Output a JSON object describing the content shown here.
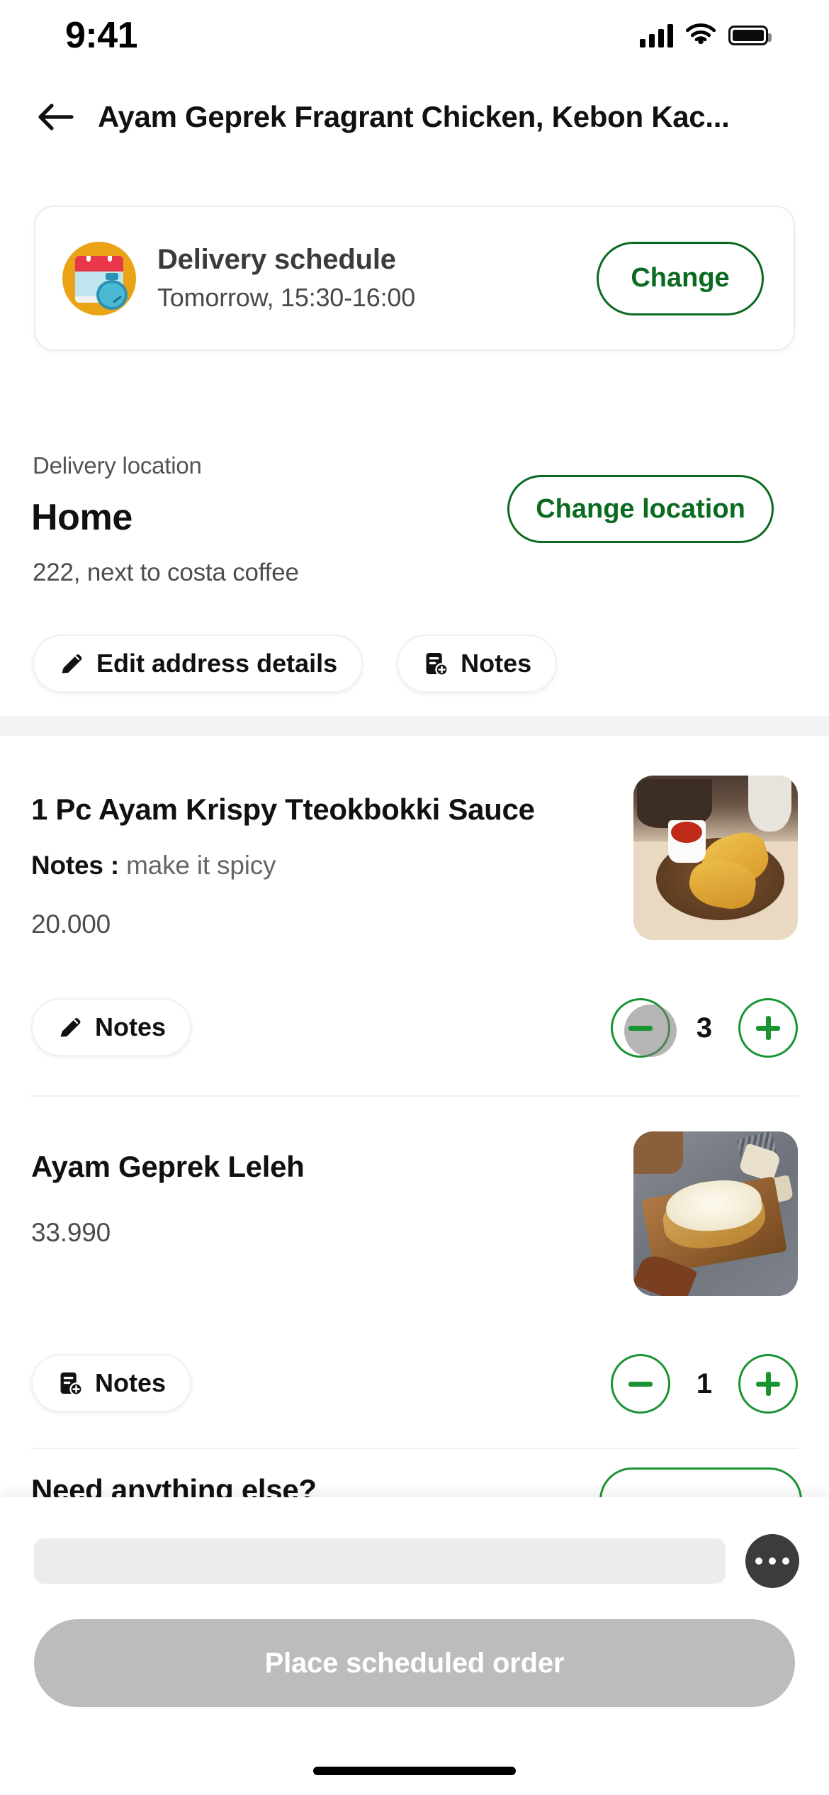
{
  "status_bar": {
    "time": "9:41",
    "signal_icon": "cellular-bars-icon",
    "wifi_icon": "wifi-icon",
    "battery_icon": "battery-full-icon"
  },
  "header": {
    "back_icon": "back-arrow-icon",
    "title": "Ayam Geprek Fragrant Chicken, Kebon Kac..."
  },
  "schedule_card": {
    "icon": "calendar-clock-icon",
    "title": "Delivery schedule",
    "subtitle": "Tomorrow, 15:30-16:00",
    "change_label": "Change"
  },
  "delivery_location": {
    "label": "Delivery location",
    "name": "Home",
    "detail": "222, next to costa coffee",
    "change_label": "Change location",
    "edit_chip": {
      "icon": "pencil-icon",
      "label": "Edit address details"
    },
    "notes_chip": {
      "icon": "note-add-icon",
      "label": "Notes"
    }
  },
  "items": [
    {
      "title": "1 Pc Ayam Krispy Tteokbokki Sauce",
      "notes_label": "Notes :",
      "notes_value": "make it spicy",
      "price": "20.000",
      "photo": "fried-chicken-wooden-board-photo",
      "notes_chip": {
        "icon": "pencil-icon",
        "label": "Notes"
      },
      "qty": "3",
      "decrement_icon": "minus-icon",
      "increment_icon": "plus-icon"
    },
    {
      "title": "Ayam Geprek Leleh",
      "price": "33.990",
      "photo": "cheesy-chicken-board-photo",
      "notes_chip": {
        "icon": "note-add-icon",
        "label": "Notes"
      },
      "qty": "1",
      "decrement_icon": "minus-icon",
      "increment_icon": "plus-icon"
    }
  ],
  "need_anything": {
    "title": "Need anything else?"
  },
  "bottom_bar": {
    "loading_placeholder": "",
    "more_icon": "more-horizontal-icon",
    "place_order_label": "Place scheduled order"
  },
  "colors": {
    "brand_green": "#1a9431",
    "dark_green": "#0a6b20",
    "disabled_gray": "#bcbcbc",
    "icon_orange": "#eaa317",
    "calendar_red": "#e8374a",
    "stopwatch_blue": "#4bb8d4"
  }
}
